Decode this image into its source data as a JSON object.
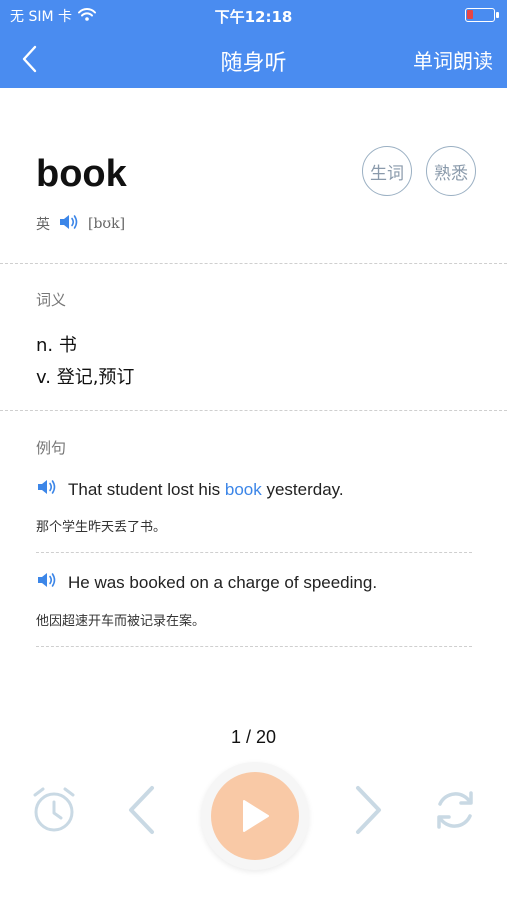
{
  "status": {
    "carrier": "无 SIM 卡",
    "time": "下午12:18"
  },
  "nav": {
    "title": "随身听",
    "right_label": "单词朗读"
  },
  "word": {
    "text": "book",
    "new_word_label": "生词",
    "familiar_label": "熟悉",
    "accent_label": "英",
    "phonetic": "[bʊk]"
  },
  "definitions": {
    "heading": "词义",
    "items": [
      "n. 书",
      "v. 登记,预订"
    ]
  },
  "examples": {
    "heading": "例句",
    "items": [
      {
        "before": "That student lost his ",
        "highlight": "book",
        "after": " yesterday.",
        "translation": "那个学生昨天丢了书。"
      },
      {
        "before": "He was booked on a charge of speeding.",
        "highlight": "",
        "after": "",
        "translation": "他因超速开车而被记录在案。"
      }
    ]
  },
  "player": {
    "counter": "1 / 20",
    "icons": [
      "alarm-clock-icon",
      "previous-icon",
      "play-icon",
      "next-icon",
      "repeat-icon"
    ]
  },
  "colors": {
    "nav_bg": "#4a8cf0",
    "highlight": "#3c86e8",
    "play_button": "#f9c9a6",
    "control_icons": "#c9d9e4"
  }
}
